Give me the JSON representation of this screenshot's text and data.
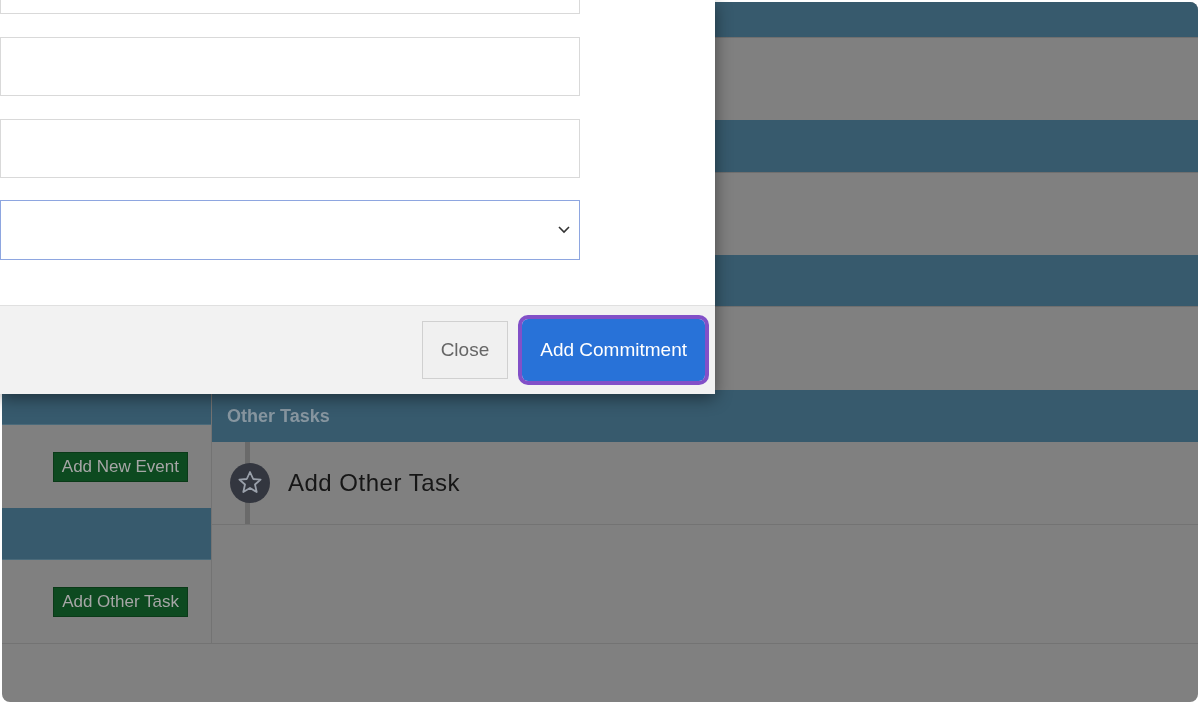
{
  "dialog": {
    "fields": [
      {
        "kind": "input",
        "focused": false
      },
      {
        "kind": "input",
        "focused": false
      },
      {
        "kind": "input",
        "focused": false
      },
      {
        "kind": "select",
        "focused": true
      }
    ],
    "buttons": [
      {
        "label": "Close",
        "kind": "secondary",
        "highlighted": false
      },
      {
        "label": "Add Commitment",
        "kind": "primary",
        "highlighted": true
      }
    ]
  },
  "left_panel": {
    "buttons": [
      "Add New Event",
      "Add Other Task"
    ]
  },
  "other_tasks": {
    "title": "Other Tasks",
    "items": [
      {
        "label": "Add Other Task"
      }
    ]
  }
}
